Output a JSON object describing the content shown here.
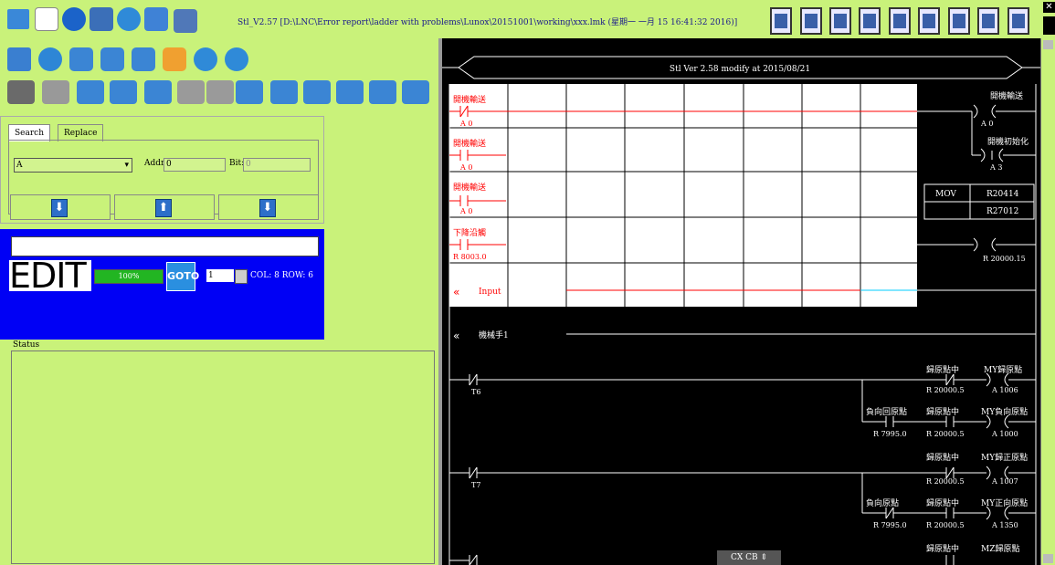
{
  "window": {
    "title": "Stl_V2.57 [D:\\LNC\\Error report\\ladder with problems\\Lunox\\20151001\\working\\xxx.lmk (星期一 一月 15 16:41:32 2016)]",
    "close_glyph": "✕"
  },
  "search_panel": {
    "tabs": [
      "Search",
      "Replace"
    ],
    "type_value": "A",
    "addr_label": "Addr:",
    "addr_value": "0",
    "bit_label": "Bit:",
    "bit_value": "0",
    "buttons": [
      "⬇",
      "⬆",
      "⬇"
    ]
  },
  "edit_panel": {
    "mode": "EDIT",
    "progress_text": "100%",
    "progress_fraction": 1.0,
    "goto_label": "GOTO",
    "goto_value": "1",
    "col_row": "COL: 8 ROW: 6"
  },
  "status_panel": {
    "label": "Status"
  },
  "ladder": {
    "header": "Stl Ver 2.58 modify at 2015/08/21",
    "rows": [
      {
        "contact_label": "開機輸送",
        "contact_addr": "A 0",
        "contact_type": "NC",
        "coil_label": "開機輸送",
        "coil_addr": "A 0"
      },
      {
        "contact_label": "開機輸送",
        "contact_addr": "A 0",
        "contact_type": "NO",
        "coil_label": "開機初始化",
        "coil_addr": "A 3",
        "coil_type": "pulse"
      },
      {
        "contact_label": "開機輸送",
        "contact_addr": "A 0",
        "contact_type": "NO",
        "mov": "MOV",
        "mov_src": "R20414",
        "mov_dst": "R27012"
      },
      {
        "contact_label": "下降沿觸",
        "contact_addr": "R 8003.0",
        "contact_type": "NO",
        "coil_addr": "R 20000.15"
      }
    ],
    "input_label": "Input",
    "manual_label": "機械手1",
    "lower": {
      "r1_contact_addr": "T6",
      "r1_coil1_label": "歸原點中",
      "r1_coil1_addr": "R 20000.5",
      "r1_coil2_label": "MY歸原點",
      "r1_coil2_addr": "A 1006",
      "r2_contact_label": "負向回原點",
      "r2_contact_addr": "R 7995.0",
      "r2_mid_label": "歸原點中",
      "r2_mid_addr": "R 20000.5",
      "r2_coil_label": "MY負向原點",
      "r2_coil_addr": "A 1000",
      "r3_contact_addr": "T7",
      "r3_coil1_label": "歸原點中",
      "r3_coil1_addr": "R 20000.5",
      "r3_coil2_label": "MY歸正原點",
      "r3_coil2_addr": "A 1007",
      "r4_contact_label": "負向原點",
      "r4_contact_addr": "R 7995.0",
      "r4_mid_label": "歸原點中",
      "r4_mid_addr": "R 20000.5",
      "r4_coil_label": "MY正向原點",
      "r4_coil_addr": "A 1350",
      "r5_coil1_label": "歸原點中",
      "r5_coil2_label": "MZ歸原點"
    },
    "cx_cb": "CX CB ⇕"
  },
  "colors": {
    "background": "#c9f27a",
    "edit_panel": "#0000f5",
    "rung_line": "#ff0000",
    "ladder_bg": "#000000"
  }
}
